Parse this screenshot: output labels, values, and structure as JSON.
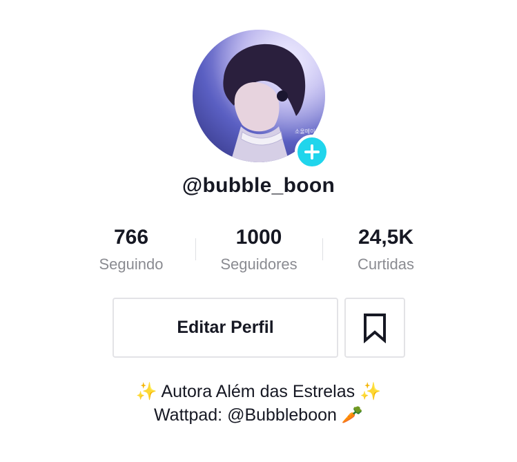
{
  "profile": {
    "username": "@bubble_boon",
    "avatar_alt": "profile photo",
    "avatar_watermark": "소울메이트"
  },
  "stats": [
    {
      "value": "766",
      "label": "Seguindo"
    },
    {
      "value": "1000",
      "label": "Seguidores"
    },
    {
      "value": "24,5K",
      "label": "Curtidas"
    }
  ],
  "actions": {
    "edit_label": "Editar Perfil",
    "favorites_icon": "bookmark-icon",
    "add_icon": "plus-icon"
  },
  "bio": {
    "line1_text": "Autora Além das Estrelas",
    "line1_emoji_left": "✨",
    "line1_emoji_right": "✨",
    "line2_text": "Wattpad: @Bubbleboon",
    "line2_emoji": "🥕"
  },
  "colors": {
    "accent": "#20d5ec",
    "text_primary": "#161823",
    "text_secondary": "#8a8b91",
    "border": "#e3e3e6"
  }
}
